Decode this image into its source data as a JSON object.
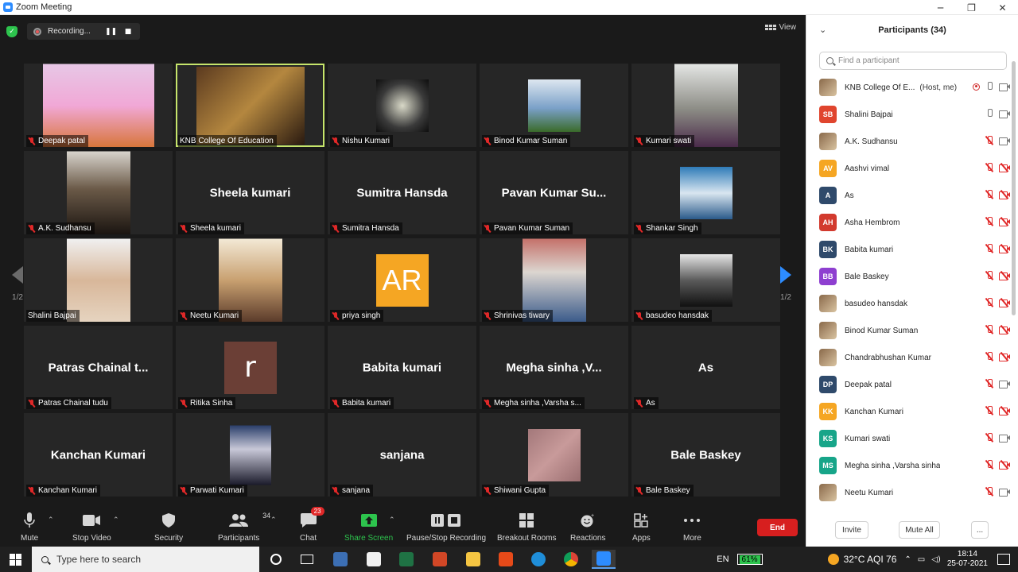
{
  "window": {
    "title": "Zoom Meeting",
    "min": "─",
    "max": "❐",
    "close": "✕"
  },
  "recording": {
    "text": "Recording...",
    "pause": "❚❚",
    "stop": "■"
  },
  "view_label": "View",
  "pager": {
    "page": "1/2"
  },
  "tiles": [
    {
      "name": "Deepak patal",
      "type": "photo",
      "muted": true
    },
    {
      "name": "KNB College Of Education",
      "type": "photo",
      "muted": false,
      "active": true
    },
    {
      "name": "Nishu Kumari",
      "type": "photo",
      "muted": true
    },
    {
      "name": "Binod Kumar Suman",
      "type": "photo",
      "muted": true
    },
    {
      "name": "Kumari swati",
      "type": "photo",
      "muted": true
    },
    {
      "name": "A.K. Sudhansu",
      "type": "photo",
      "muted": true
    },
    {
      "name": "Sheela kumari",
      "type": "text",
      "display": "Sheela kumari",
      "muted": true
    },
    {
      "name": "Sumitra Hansda",
      "type": "text",
      "display": "Sumitra Hansda",
      "muted": true
    },
    {
      "name": "Pavan Kumar Suman",
      "type": "text",
      "display": "Pavan Kumar Su...",
      "muted": true
    },
    {
      "name": "Shankar Singh",
      "type": "photo",
      "muted": true
    },
    {
      "name": "Shalini Bajpai",
      "type": "photo",
      "muted": false
    },
    {
      "name": "Neetu Kumari",
      "type": "photo",
      "muted": true
    },
    {
      "name": "priya singh",
      "type": "avatar",
      "initials": "AR",
      "muted": true
    },
    {
      "name": "Shrinivas tiwary",
      "type": "photo",
      "muted": true
    },
    {
      "name": "basudeo hansdak",
      "type": "photo",
      "muted": true
    },
    {
      "name": "Patras Chainal tudu",
      "type": "text",
      "display": "Patras Chainal t...",
      "muted": true
    },
    {
      "name": "Ritika Sinha",
      "type": "avatar",
      "initials": "r",
      "muted": true
    },
    {
      "name": "Babita kumari",
      "type": "text",
      "display": "Babita kumari",
      "muted": true
    },
    {
      "name": "Megha sinha ,Varsha s...",
      "type": "text",
      "display": "Megha sinha ,V...",
      "muted": true
    },
    {
      "name": "As",
      "type": "text",
      "display": "As",
      "muted": true
    },
    {
      "name": "Kanchan Kumari",
      "type": "text",
      "display": "Kanchan Kumari",
      "muted": true
    },
    {
      "name": "Parwati Kumari",
      "type": "photo",
      "muted": true
    },
    {
      "name": "sanjana",
      "type": "text",
      "display": "sanjana",
      "muted": true
    },
    {
      "name": "Shiwani Gupta",
      "type": "photo",
      "muted": true
    },
    {
      "name": "Bale Baskey",
      "type": "text",
      "display": "Bale Baskey",
      "muted": true
    }
  ],
  "toolbar": {
    "mute": "Mute",
    "stop_video": "Stop Video",
    "security": "Security",
    "participants": "Participants",
    "participants_count": "34",
    "chat": "Chat",
    "chat_badge": "23",
    "share_screen": "Share Screen",
    "pause_recording": "Pause/Stop Recording",
    "breakout": "Breakout Rooms",
    "reactions": "Reactions",
    "apps": "Apps",
    "more": "More",
    "end": "End"
  },
  "panel": {
    "title": "Participants (34)",
    "search_placeholder": "Find a participant",
    "invite": "Invite",
    "mute_all": "Mute All",
    "more": "...",
    "participants": [
      {
        "name": "KNB College Of E...",
        "role": "(Host, me)",
        "initials": "",
        "color": "",
        "img": true,
        "rec": true,
        "mic": "on",
        "cam": "on"
      },
      {
        "name": "Shalini Bajpai",
        "role": "",
        "initials": "SB",
        "color": "#e0452e",
        "img": false,
        "rec": false,
        "mic": "on",
        "cam": "on"
      },
      {
        "name": "A.K. Sudhansu",
        "role": "",
        "initials": "",
        "color": "",
        "img": true,
        "rec": false,
        "mic": "off",
        "cam": "on"
      },
      {
        "name": "Aashvi vimal",
        "role": "",
        "initials": "AV",
        "color": "#f5a623",
        "img": false,
        "rec": false,
        "mic": "off",
        "cam": "off"
      },
      {
        "name": "As",
        "role": "",
        "initials": "A",
        "color": "#2f4a6b",
        "img": false,
        "rec": false,
        "mic": "off",
        "cam": "off"
      },
      {
        "name": "Asha Hembrom",
        "role": "",
        "initials": "AH",
        "color": "#d23a2e",
        "img": false,
        "rec": false,
        "mic": "off",
        "cam": "off"
      },
      {
        "name": "Babita kumari",
        "role": "",
        "initials": "BK",
        "color": "#2f4a6b",
        "img": false,
        "rec": false,
        "mic": "off",
        "cam": "off"
      },
      {
        "name": "Bale Baskey",
        "role": "",
        "initials": "BB",
        "color": "#8e3fd0",
        "img": false,
        "rec": false,
        "mic": "off",
        "cam": "off"
      },
      {
        "name": "basudeo hansdak",
        "role": "",
        "initials": "",
        "color": "",
        "img": true,
        "rec": false,
        "mic": "off",
        "cam": "off"
      },
      {
        "name": "Binod Kumar Suman",
        "role": "",
        "initials": "",
        "color": "",
        "img": true,
        "rec": false,
        "mic": "off",
        "cam": "off"
      },
      {
        "name": "Chandrabhushan Kumar",
        "role": "",
        "initials": "",
        "color": "",
        "img": true,
        "rec": false,
        "mic": "off",
        "cam": "off"
      },
      {
        "name": "Deepak patal",
        "role": "",
        "initials": "DP",
        "color": "#2f4a6b",
        "img": false,
        "rec": false,
        "mic": "off",
        "cam": "on"
      },
      {
        "name": "Kanchan Kumari",
        "role": "",
        "initials": "KK",
        "color": "#f5a623",
        "img": false,
        "rec": false,
        "mic": "off",
        "cam": "off"
      },
      {
        "name": "Kumari swati",
        "role": "",
        "initials": "KS",
        "color": "#17a589",
        "img": false,
        "rec": false,
        "mic": "off",
        "cam": "on"
      },
      {
        "name": "Megha sinha ,Varsha sinha",
        "role": "",
        "initials": "MS",
        "color": "#17a589",
        "img": false,
        "rec": false,
        "mic": "off",
        "cam": "off"
      },
      {
        "name": "Neetu Kumari",
        "role": "",
        "initials": "",
        "color": "",
        "img": true,
        "rec": false,
        "mic": "off",
        "cam": "on"
      }
    ]
  },
  "taskbar": {
    "search_placeholder": "Type here to search",
    "lang": "EN",
    "battery": "61%",
    "weather": "32°C  AQI 76",
    "time": "18:14",
    "date": "25-07-2021"
  }
}
